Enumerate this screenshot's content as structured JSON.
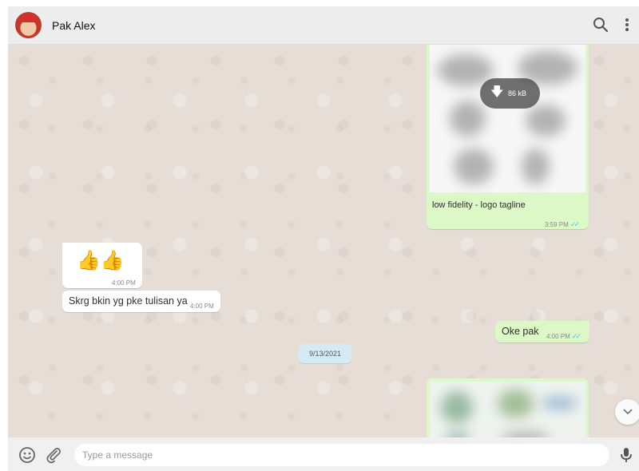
{
  "header": {
    "contact_name": "Pak Alex"
  },
  "messages": [
    {
      "direction": "outgoing",
      "type": "image",
      "download_size": "86 kB",
      "caption": "low fidelity - logo tagline",
      "time": "3:59 PM",
      "status": "read"
    },
    {
      "direction": "incoming",
      "type": "emoji",
      "emoji": "👍👍",
      "time": "4:00 PM"
    },
    {
      "direction": "incoming",
      "type": "text",
      "text": "Skrg bkin yg pke tulisan ya",
      "time": "4:00 PM"
    },
    {
      "direction": "outgoing",
      "type": "text",
      "text": "Oke pak",
      "time": "4:00 PM",
      "status": "read"
    },
    {
      "direction": "outgoing",
      "type": "image",
      "time": ""
    }
  ],
  "date_divider": "9/13/2021",
  "composer": {
    "placeholder": "Type a message",
    "value": ""
  },
  "colors": {
    "outgoing_bubble": "#dcf8c6",
    "incoming_bubble": "#ffffff",
    "read_ticks": "#4fc3f7",
    "chat_background": "#e6ded6"
  },
  "icons": [
    "search-icon",
    "menu-icon",
    "download-icon",
    "chevron-down-icon",
    "emoji-icon",
    "attach-icon",
    "microphone-icon",
    "read-receipt-icon"
  ]
}
